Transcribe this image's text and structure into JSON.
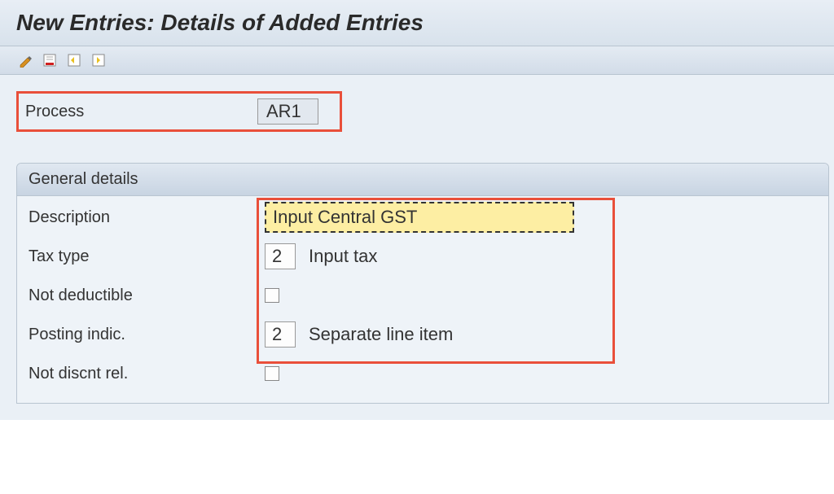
{
  "header": {
    "title": "New Entries: Details of Added Entries"
  },
  "toolbar": {
    "icons": [
      "create-icon",
      "delete-icon",
      "previous-entry-icon",
      "next-entry-icon"
    ]
  },
  "process": {
    "label": "Process",
    "value": "AR1"
  },
  "group": {
    "title": "General details",
    "fields": {
      "description": {
        "label": "Description",
        "value": "Input Central GST"
      },
      "tax_type": {
        "label": "Tax type",
        "value": "2",
        "text": "Input tax"
      },
      "not_deductible": {
        "label": "Not deductible",
        "checked": false
      },
      "posting_indic": {
        "label": "Posting indic.",
        "value": "2",
        "text": "Separate line item"
      },
      "not_discnt_rel": {
        "label": "Not discnt rel.",
        "checked": false
      }
    }
  }
}
